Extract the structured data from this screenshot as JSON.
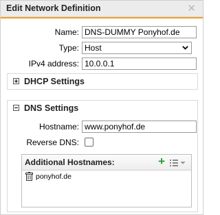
{
  "dialog": {
    "title": "Edit Network Definition",
    "close_icon": "close-icon"
  },
  "form": {
    "name_label": "Name:",
    "name_value": "DNS-DUMMY Ponyhof.de",
    "type_label": "Type:",
    "type_value": "Host",
    "ipv4_label": "IPv4 address:",
    "ipv4_value": "10.0.0.1"
  },
  "dhcp": {
    "title": "DHCP Settings",
    "expanded": false
  },
  "dns": {
    "title": "DNS Settings",
    "expanded": true,
    "hostname_label": "Hostname:",
    "hostname_value": "www.ponyhof.de",
    "reverse_dns_label": "Reverse DNS:",
    "reverse_dns_checked": false,
    "additional": {
      "title": "Additional Hostnames:",
      "rows": [
        {
          "host": "ponyhof.de"
        }
      ]
    }
  },
  "colors": {
    "accent": "#f39c1f",
    "add_green": "#2e9a2e"
  }
}
